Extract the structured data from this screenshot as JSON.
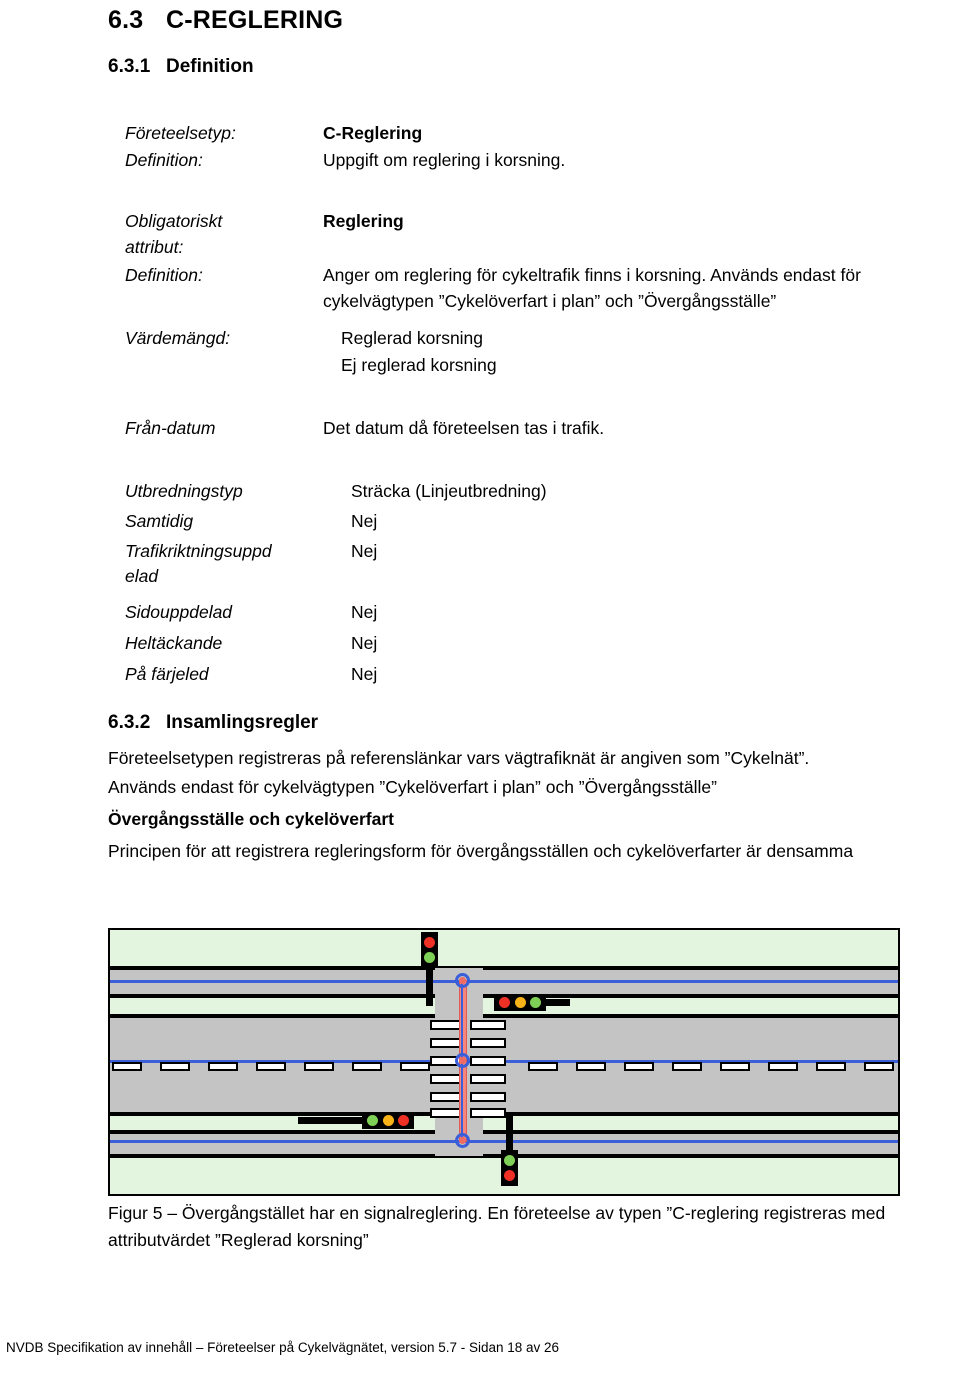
{
  "document": {
    "section_number": "6.3",
    "section_title": "C-REGLERING",
    "subsection_1_number": "6.3.1",
    "subsection_1_title": "Definition",
    "subsection_2_number": "6.3.2",
    "subsection_2_title": "Insamlingsregler"
  },
  "definition_block": {
    "rows": [
      {
        "label": "Företeelsetyp:",
        "value": "C-Reglering"
      },
      {
        "label": "Definition:",
        "value": "Uppgift om reglering i korsning."
      }
    ]
  },
  "attribute_block": {
    "label_obligatoriskt_line1": "Obligatoriskt",
    "label_obligatoriskt_line2": "attribut:",
    "value_obligatoriskt": "Reglering",
    "label_definition": "Definition:",
    "value_definition": "Anger om reglering för cykeltrafik finns i korsning. Används endast för cykelvägtypen ”Cykelöverfart i plan” och ”Övergångsställe”",
    "label_vardemangd": "Värdemängd:",
    "value_vardemangd_1": "Reglerad korsning",
    "value_vardemangd_2": "Ej reglerad korsning"
  },
  "fran_datum": {
    "label": "Från-datum",
    "value": "Det datum då företeelsen tas i trafik."
  },
  "properties": [
    {
      "label": "Utbredningstyp",
      "value": "Sträcka (Linjeutbredning)"
    },
    {
      "label": "Samtidig",
      "value": "Nej"
    },
    {
      "label": "Trafikriktningsuppd",
      "label_line2": "elad",
      "value": "Nej"
    },
    {
      "label": "Sidouppdelad",
      "value": "Nej"
    },
    {
      "label": "Heltäckande",
      "value": "Nej"
    },
    {
      "label": "På färjeled",
      "value": "Nej"
    }
  ],
  "insamlingsregler": {
    "paragraph_1": "Företeelsetypen registreras på referenslänkar vars vägtrafiknät är angiven som ”Cykelnät”.",
    "paragraph_2": "Används endast för cykelvägtypen ”Cykelöverfart i plan” och ”Övergångsställe”",
    "paragraph_3_bold": "Övergångsställe och cykelöverfart",
    "paragraph_4": "Principen för att registrera regleringsform för övergångsställen och cykelöverfarter är densamma"
  },
  "figure": {
    "caption": "Figur 5 – Övergångstället har en signalreglering. En företeelse av typen ”C-reglering registreras med attributvärdet ”Reglerad korsning”",
    "colors": {
      "grass": "#e3f5df",
      "road": "#c4c4c4",
      "network_link": "#3a5fd9",
      "crossing_link": "#f4857f",
      "lamp_red": "#ee3124",
      "lamp_yellow": "#f7b318",
      "lamp_green": "#7ed156"
    },
    "signals": [
      {
        "name": "top-vertical-signal",
        "orientation": "vertical",
        "lamps": [
          "red",
          "green"
        ]
      },
      {
        "name": "upper-right-horizontal-signal",
        "orientation": "horizontal",
        "lamps": [
          "red",
          "yellow",
          "green"
        ]
      },
      {
        "name": "lower-left-horizontal-signal",
        "orientation": "horizontal",
        "lamps": [
          "green",
          "yellow",
          "red"
        ]
      },
      {
        "name": "bottom-vertical-signal",
        "orientation": "vertical",
        "lamps": [
          "green",
          "red"
        ]
      }
    ],
    "nodes_count": 3,
    "zebra_stripe_rows": 6
  },
  "footer": {
    "text": "NVDB Specifikation av innehåll – Företeelser på Cykelvägnätet, version 5.7 - Sidan 18 av 26"
  }
}
